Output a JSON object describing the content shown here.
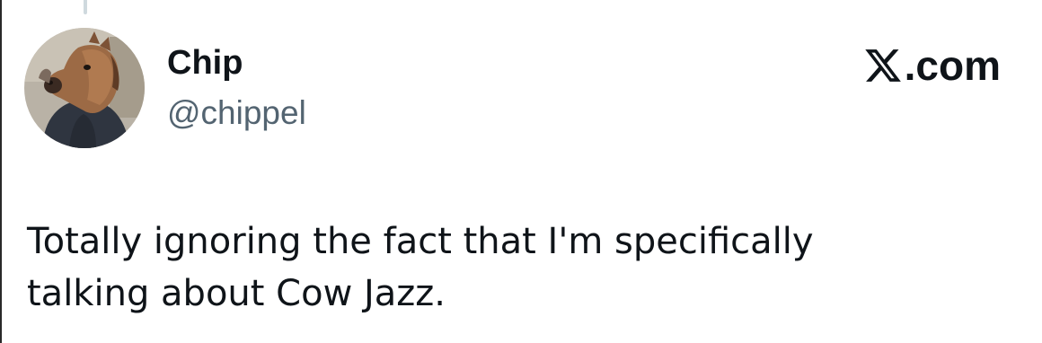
{
  "author": {
    "display_name": "Chip",
    "handle": "@chippel",
    "avatar_icon": "horse-mask-avatar-icon"
  },
  "brand": {
    "icon": "x-logo-icon",
    "domain_suffix": ".com"
  },
  "tweet": {
    "lines": [
      "Totally ignoring the fact that I'm specifically",
      "talking about Cow Jazz."
    ]
  },
  "colors": {
    "text": "#0f1419",
    "handle": "#536471",
    "background": "#ffffff",
    "thread_line": "#cfd9de"
  }
}
